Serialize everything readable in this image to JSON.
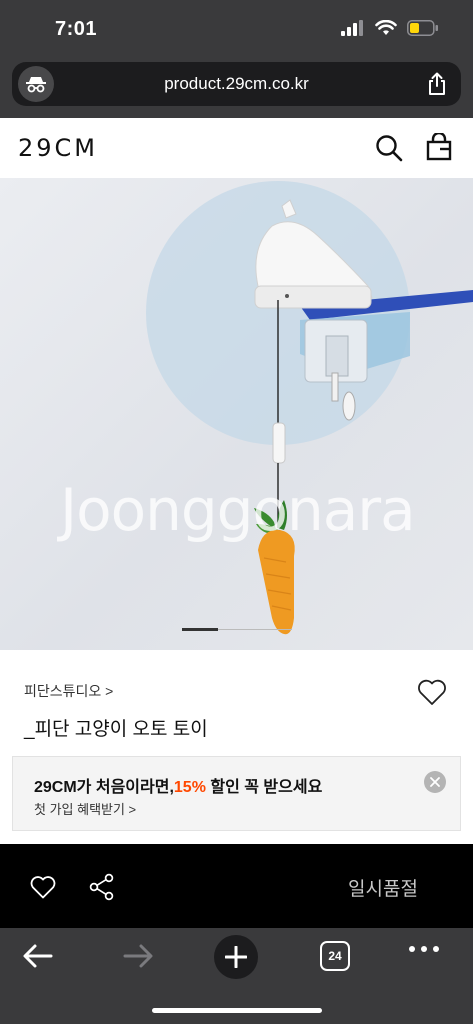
{
  "status": {
    "time": "7:01",
    "battery_color": "#ffd60a"
  },
  "browser": {
    "url": "product.29cm.co.kr",
    "tab_count": "24"
  },
  "site": {
    "logo": "29CM"
  },
  "product": {
    "watermark": "Joonggonara",
    "carousel": {
      "current_index": 1
    },
    "brand": "피단스튜디오 >",
    "title": "_피단 고양이 오토 토이"
  },
  "promo": {
    "title_prefix": "29CM가 처음이라면,",
    "title_accent": "15%",
    "title_suffix": " 할인 꼭 받으세요",
    "link": "첫 가입 혜택받기 >",
    "accent_color": "#ff4800"
  },
  "action": {
    "soldout_label": "일시품절"
  },
  "icons": [
    "incognito-icon",
    "share-icon",
    "search-icon",
    "shopping-bag-icon",
    "heart-icon",
    "close-icon",
    "back-arrow-icon",
    "forward-arrow-icon",
    "plus-icon",
    "more-icon"
  ]
}
